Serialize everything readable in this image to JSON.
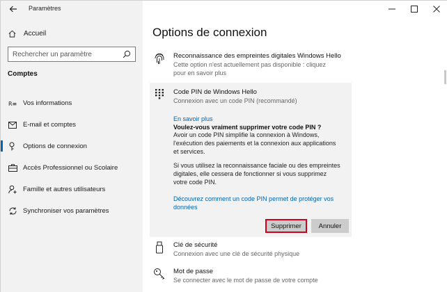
{
  "window": {
    "title": "Paramètres"
  },
  "sidebar": {
    "home_label": "Accueil",
    "search_placeholder": "Rechercher un paramètre",
    "section_title": "Comptes",
    "items": [
      {
        "label": "Vos informations",
        "icon": "person-card-icon"
      },
      {
        "label": "E-mail et comptes",
        "icon": "mail-icon"
      },
      {
        "label": "Options de connexion",
        "icon": "key-icon",
        "active": true
      },
      {
        "label": "Accès Professionnel ou Scolaire",
        "icon": "briefcase-icon"
      },
      {
        "label": "Famille et autres utilisateurs",
        "icon": "add-person-icon"
      },
      {
        "label": "Synchroniser vos paramètres",
        "icon": "sync-icon"
      }
    ]
  },
  "main": {
    "title": "Options de connexion",
    "fingerprint": {
      "title": "Reconnaissance des empreintes digitales Windows Hello",
      "desc_line1": "Cette option n'est actuellement pas disponible : cliquez",
      "desc_line2": "pour en savoir plus"
    },
    "pin": {
      "title": "Code PIN de Windows Hello",
      "desc": "Connexion avec un code PIN (recommandé)",
      "learn_more": "En savoir plus",
      "question": "Voulez-vous vraiment supprimer votre code PIN ?",
      "para1_line1": "Avoir un code PIN simplifie la connexion à Windows,",
      "para1_line2": "l'exécution des paiements et la connexion aux applications",
      "para1_line3": "et services.",
      "para2_line1": "Si vous utilisez la reconnaissance faciale ou des empreintes",
      "para2_line2": "digitales, elle cessera de fonctionner si vous supprimez",
      "para2_line3": "votre code PIN.",
      "discover_line1": "Découvrez comment un code PIN permet de protéger vos",
      "discover_line2": "données",
      "delete_button": "Supprimer",
      "cancel_button": "Annuler"
    },
    "security_key": {
      "title": "Clé de sécurité",
      "desc": "Connexion avec une clé de sécurité physique"
    },
    "password": {
      "title": "Mot de passe",
      "desc": "Se connecter avec le mot de passe de votre compte"
    }
  },
  "colors": {
    "accent": "#0063b1",
    "highlight_border": "#d0021b",
    "panel_bg": "#f2f2f2",
    "sidebar_bg": "#f2f2f2"
  }
}
